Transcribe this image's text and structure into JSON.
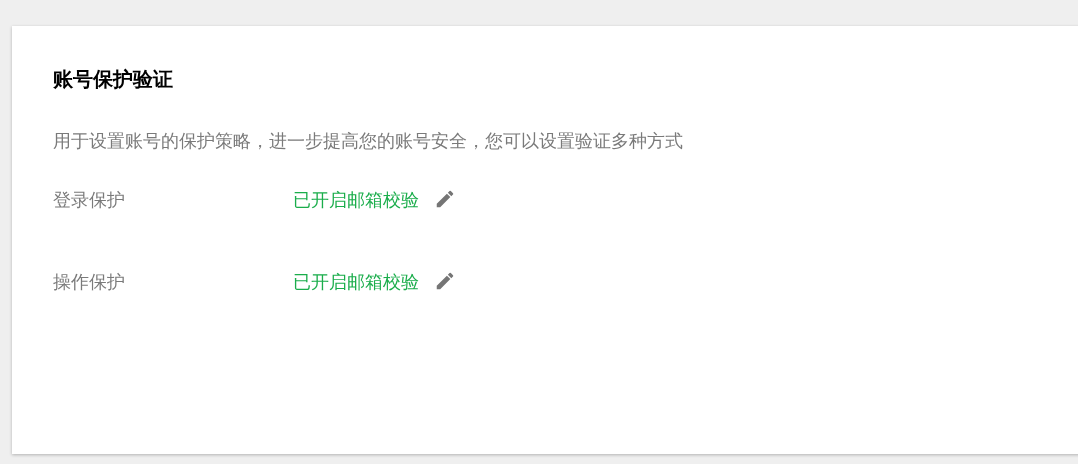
{
  "card": {
    "title": "账号保护验证",
    "description": "用于设置账号的保护策略，进一步提高您的账号安全，您可以设置验证多种方式",
    "settings": [
      {
        "label": "登录保护",
        "status": "已开启邮箱校验"
      },
      {
        "label": "操作保护",
        "status": "已开启邮箱校验"
      }
    ]
  }
}
